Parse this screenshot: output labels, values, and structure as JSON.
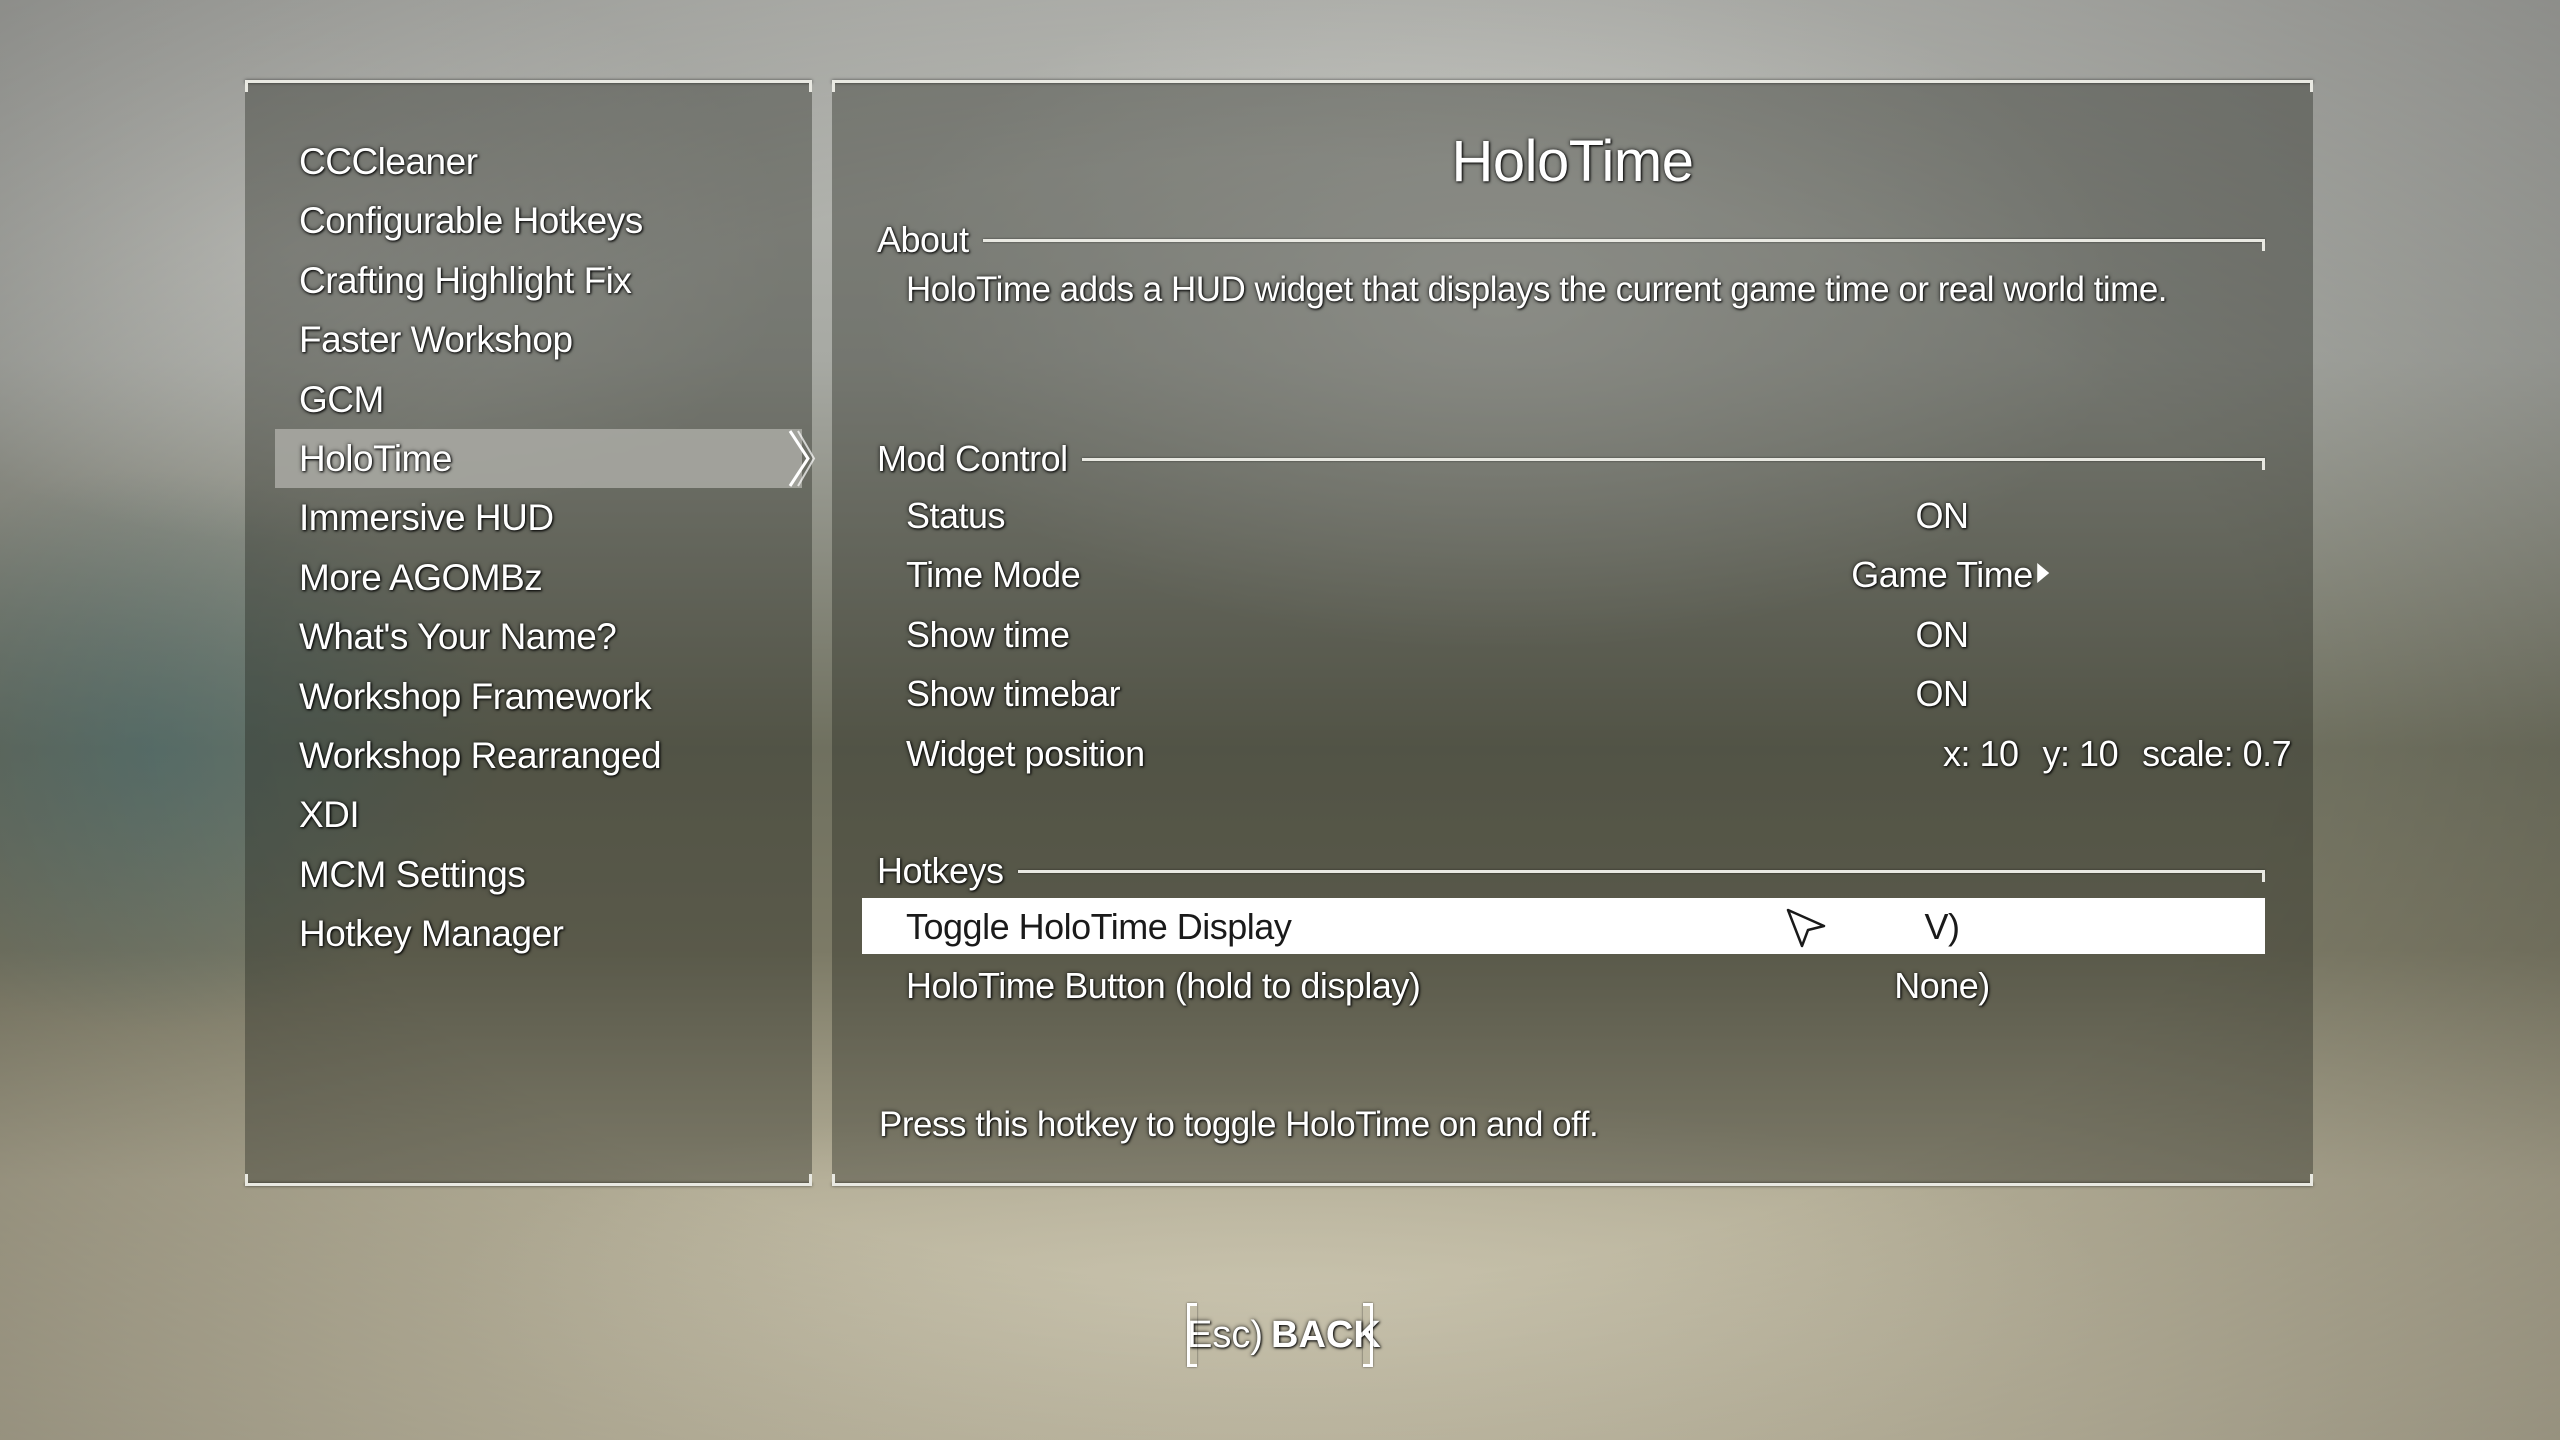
{
  "menu": {
    "items": [
      {
        "label": "CCCleaner"
      },
      {
        "label": "Configurable Hotkeys"
      },
      {
        "label": "Crafting Highlight Fix"
      },
      {
        "label": "Faster Workshop"
      },
      {
        "label": "GCM"
      },
      {
        "label": "HoloTime",
        "selected": true
      },
      {
        "label": "Immersive HUD"
      },
      {
        "label": "More AGOMBz"
      },
      {
        "label": "What's Your Name?"
      },
      {
        "label": "Workshop Framework"
      },
      {
        "label": "Workshop Rearranged"
      },
      {
        "label": "XDI"
      },
      {
        "label": "MCM Settings"
      },
      {
        "label": "Hotkey Manager"
      }
    ]
  },
  "detail": {
    "title": "HoloTime",
    "about": {
      "header": "About",
      "text": "HoloTime adds a HUD widget that displays the current game time or real world time."
    },
    "mod_control": {
      "header": "Mod Control",
      "status": {
        "label": "Status",
        "value": "ON"
      },
      "time_mode": {
        "label": "Time Mode",
        "value": "Game Time"
      },
      "show_time": {
        "label": "Show time",
        "value": "ON"
      },
      "show_timebar": {
        "label": "Show timebar",
        "value": "ON"
      },
      "widget_position": {
        "label": "Widget position",
        "x": "x: 10",
        "y": "y: 10",
        "scale": "scale: 0.7"
      }
    },
    "hotkeys": {
      "header": "Hotkeys",
      "toggle_display": {
        "label": "Toggle HoloTime Display",
        "value": "V)"
      },
      "hold_button": {
        "label": "HoloTime Button (hold to display)",
        "value": "None)"
      }
    },
    "help_text": "Press this hotkey to toggle HoloTime on and off."
  },
  "footer": {
    "back_key": "Esc)",
    "back_label": "BACK"
  },
  "colors": {
    "frame": "#e9e9e2",
    "highlight_bg": "#ffffff",
    "selected_menu_bg": "#aaaaa5"
  }
}
